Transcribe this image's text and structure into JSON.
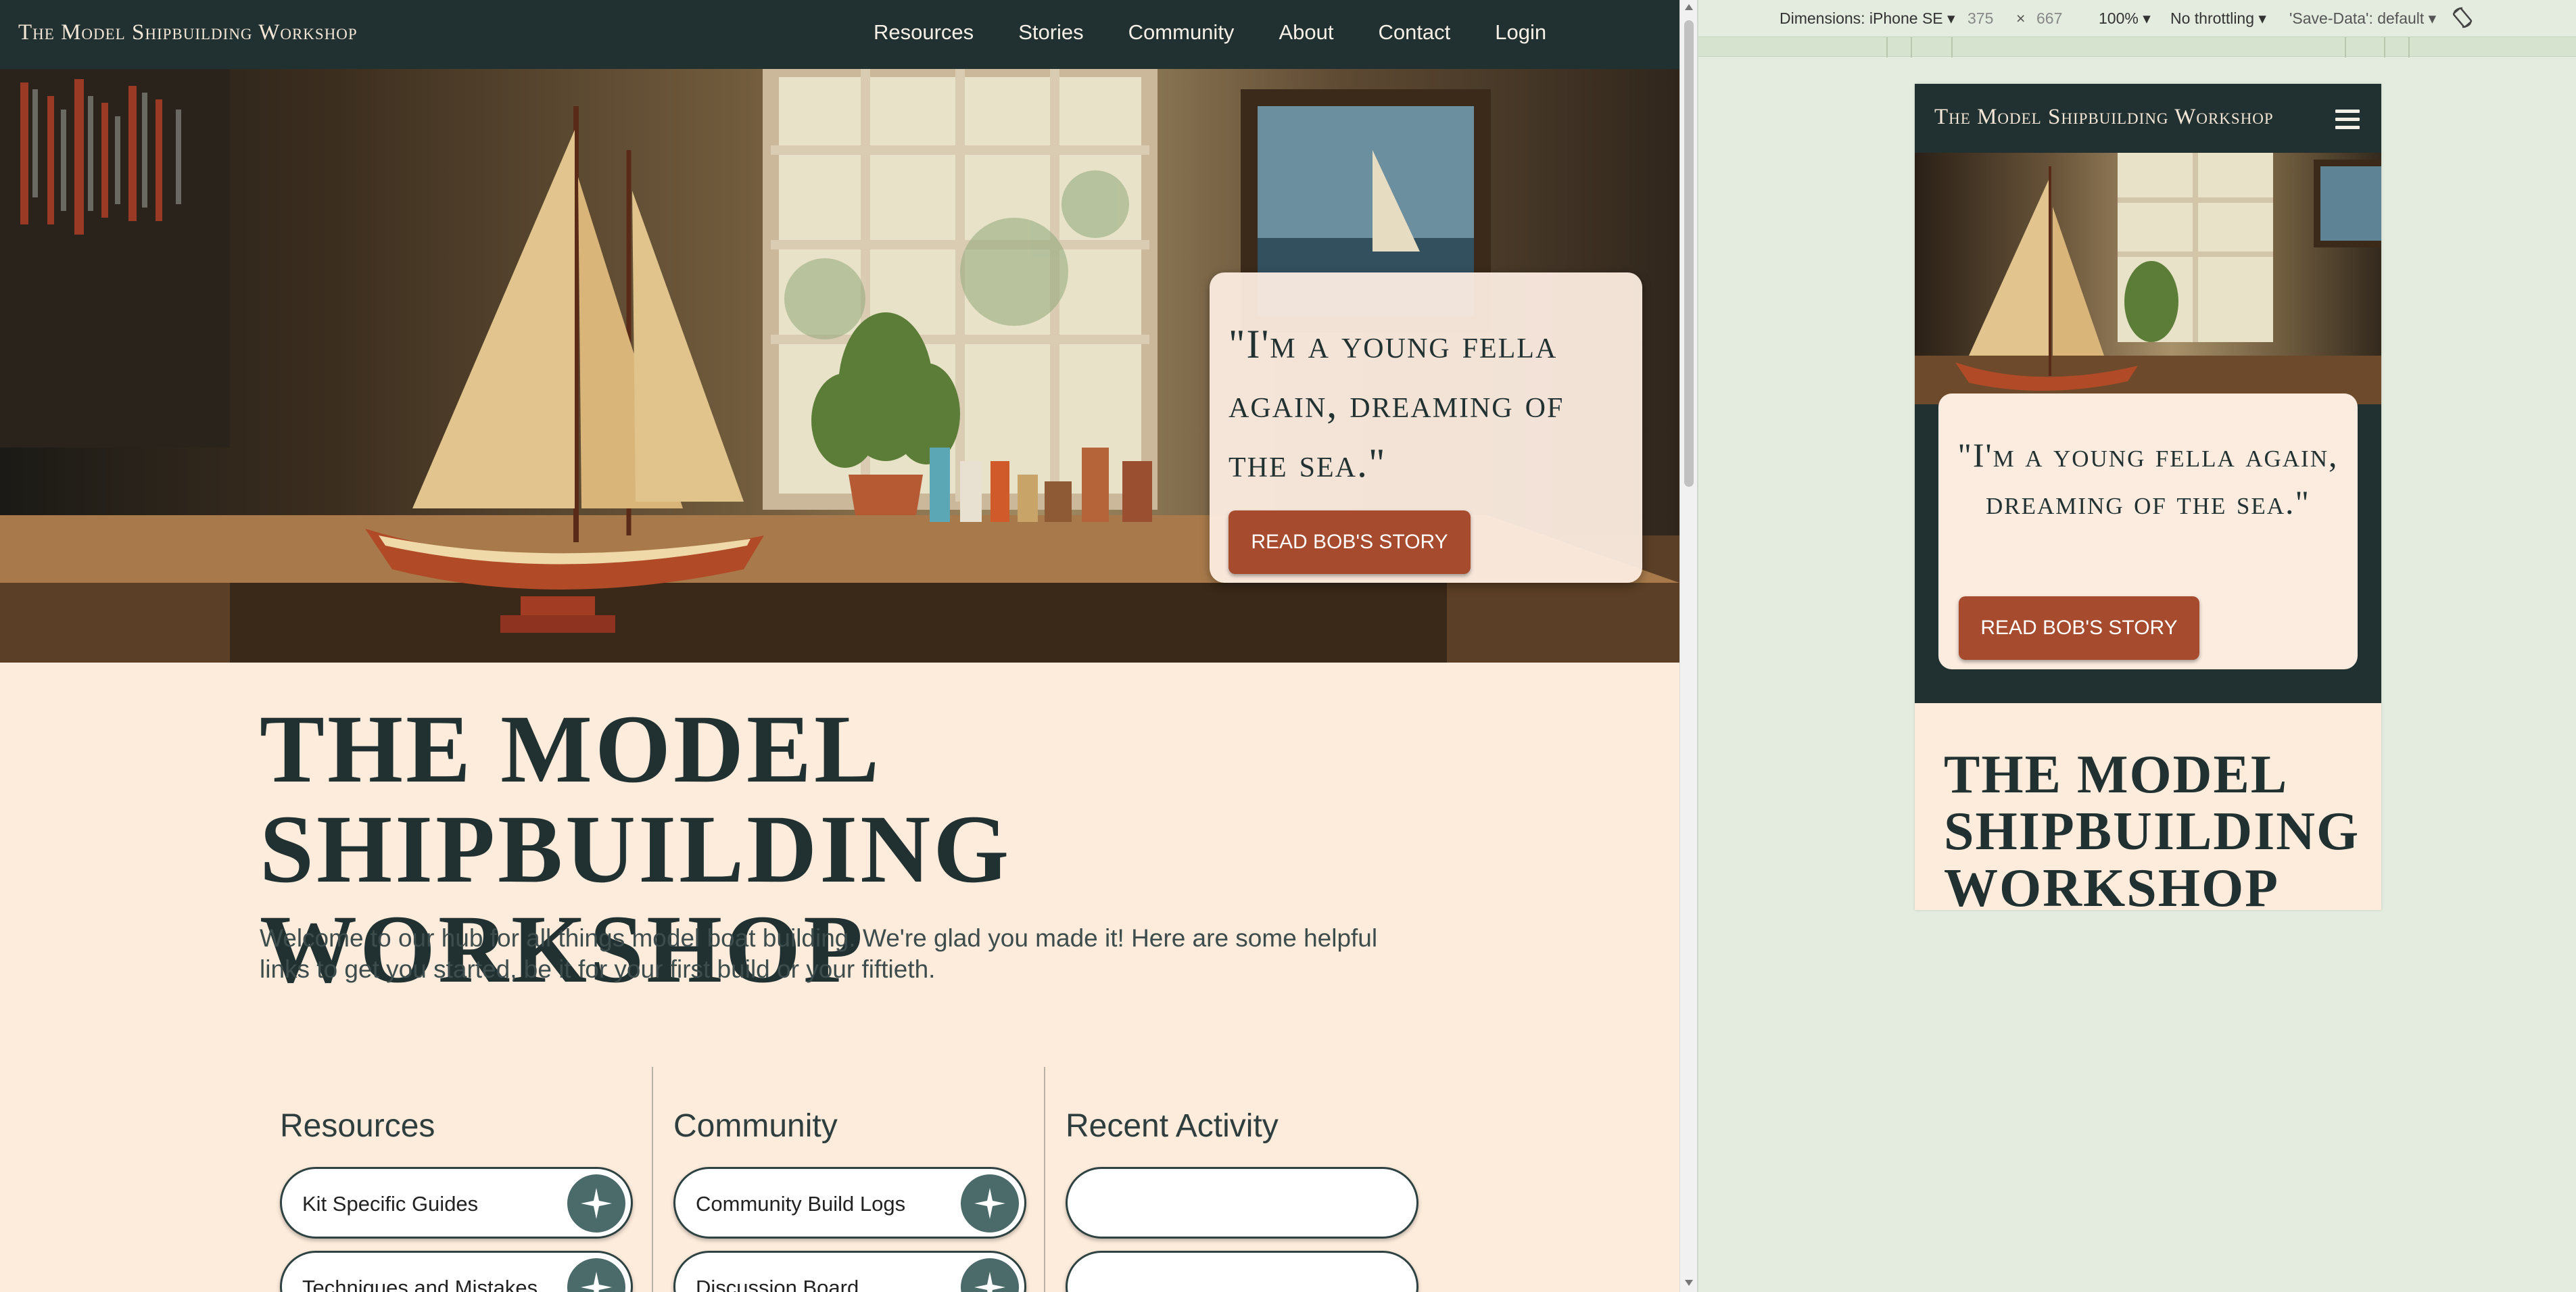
{
  "site": {
    "brand": "The Model Shipbuilding Workshop",
    "nav": [
      "Resources",
      "Stories",
      "Community",
      "About",
      "Contact",
      "Login"
    ]
  },
  "hero": {
    "quote": "\"I'm a young fella again, dreaming of the sea.\"",
    "button": "READ BOB'S STORY"
  },
  "main": {
    "title": "THE MODEL SHIPBUILDING WORKSHOP",
    "intro": "Welcome to our hub for all things model boat building. We're glad you made it! Here are some helpful links to get you started, be it for your first build or your fiftieth."
  },
  "columns": [
    {
      "heading": "Resources",
      "links": [
        "Kit Specific Guides",
        "Techniques and Mistakes"
      ]
    },
    {
      "heading": "Community",
      "links": [
        "Community Build Logs",
        "Discussion Board"
      ]
    },
    {
      "heading": "Recent Activity",
      "links": [
        "",
        ""
      ]
    }
  ],
  "devtools": {
    "dimensions": "Dimensions: iPhone SE",
    "width": "375",
    "times": "×",
    "height": "667",
    "zoom": "100%",
    "throttling": "No throttling",
    "save_data": "'Save-Data': default"
  },
  "mobile": {
    "brand": "The Model Shipbuilding Workshop",
    "quote": "\"I'm a young fella again, dreaming of the sea.\"",
    "button": "READ BOB'S STORY",
    "title": "THE MODEL SHIPBUILDING WORKSHOP"
  },
  "colors": {
    "nav_bg": "#213131",
    "page_bg": "#fdebdb",
    "accent_button": "#a64b2e",
    "pill_icon": "#4b6a6a",
    "devtools_bg": "#e4ecdf"
  },
  "icons": {
    "pill": "compass-star-icon",
    "menu": "hamburger-menu-icon",
    "rotate": "rotate-device-icon"
  }
}
